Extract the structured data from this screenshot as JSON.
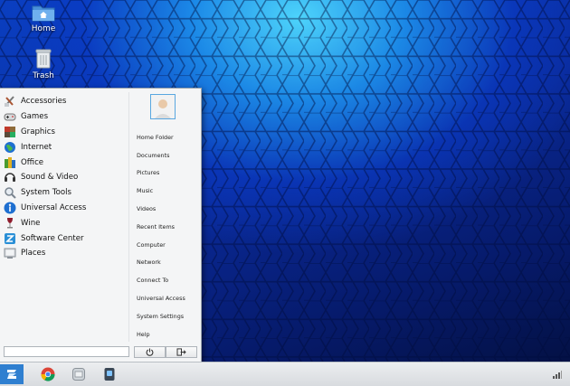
{
  "desktop": {
    "icons": [
      {
        "label": "Home",
        "icon": "folder-home-icon"
      },
      {
        "label": "Trash",
        "icon": "trash-icon"
      }
    ]
  },
  "menu": {
    "categories": [
      {
        "label": "Accessories",
        "icon": "accessories-icon"
      },
      {
        "label": "Games",
        "icon": "games-icon"
      },
      {
        "label": "Graphics",
        "icon": "graphics-icon"
      },
      {
        "label": "Internet",
        "icon": "internet-icon"
      },
      {
        "label": "Office",
        "icon": "office-icon"
      },
      {
        "label": "Sound & Video",
        "icon": "sound-video-icon"
      },
      {
        "label": "System Tools",
        "icon": "system-tools-icon"
      },
      {
        "label": "Universal Access",
        "icon": "universal-access-icon"
      },
      {
        "label": "Wine",
        "icon": "wine-icon"
      },
      {
        "label": "Software Center",
        "icon": "software-center-icon"
      },
      {
        "label": "Places",
        "icon": "places-icon"
      }
    ],
    "places": [
      "Home Folder",
      "Documents",
      "Pictures",
      "Music",
      "Videos",
      "Recent Items",
      "Computer",
      "Network",
      "Connect To",
      "Universal Access",
      "System Settings",
      "Help"
    ],
    "search_value": "",
    "power_icon": "power-icon",
    "logout_icon": "logout-icon"
  },
  "taskbar": {
    "start_icon": "zorin-logo-icon",
    "apps": [
      "chrome-icon",
      "file-manager-icon",
      "software-icon"
    ],
    "tray": [
      "network-signal-icon"
    ]
  },
  "colors": {
    "wallpaper_light": "#4fd0ff",
    "wallpaper_dark": "#061a6a",
    "menu_bg": "#f4f5f6",
    "accent": "#1e8fe0"
  }
}
